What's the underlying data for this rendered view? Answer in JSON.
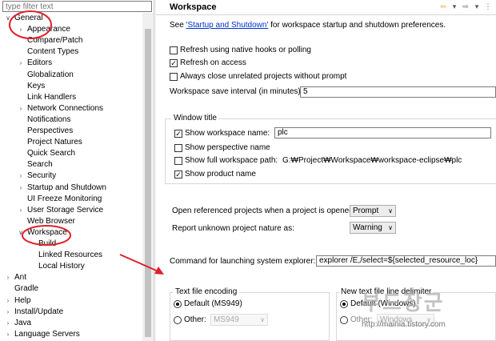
{
  "left": {
    "filter_placeholder": "type filter text",
    "tree": [
      {
        "label": "General",
        "twisty": "v"
      },
      {
        "label": "Appearance",
        "twisty": ">"
      },
      {
        "label": "Compare/Patch",
        "twisty": ""
      },
      {
        "label": "Content Types",
        "twisty": ""
      },
      {
        "label": "Editors",
        "twisty": ">"
      },
      {
        "label": "Globalization",
        "twisty": ""
      },
      {
        "label": "Keys",
        "twisty": ""
      },
      {
        "label": "Link Handlers",
        "twisty": ""
      },
      {
        "label": "Network Connections",
        "twisty": ">"
      },
      {
        "label": "Notifications",
        "twisty": ""
      },
      {
        "label": "Perspectives",
        "twisty": ""
      },
      {
        "label": "Project Natures",
        "twisty": ""
      },
      {
        "label": "Quick Search",
        "twisty": ""
      },
      {
        "label": "Search",
        "twisty": ""
      },
      {
        "label": "Security",
        "twisty": ">"
      },
      {
        "label": "Startup and Shutdown",
        "twisty": ">"
      },
      {
        "label": "UI Freeze Monitoring",
        "twisty": ""
      },
      {
        "label": "User Storage Service",
        "twisty": ">"
      },
      {
        "label": "Web Browser",
        "twisty": ""
      },
      {
        "label": "Workspace",
        "twisty": "v"
      },
      {
        "label": "Build",
        "twisty": ""
      },
      {
        "label": "Linked Resources",
        "twisty": ""
      },
      {
        "label": "Local History",
        "twisty": ""
      },
      {
        "label": "Ant",
        "twisty": ">"
      },
      {
        "label": "Gradle",
        "twisty": ""
      },
      {
        "label": "Help",
        "twisty": ">"
      },
      {
        "label": "Install/Update",
        "twisty": ">"
      },
      {
        "label": "Java",
        "twisty": ">"
      },
      {
        "label": "Language Servers",
        "twisty": ">"
      }
    ]
  },
  "right": {
    "title": "Workspace",
    "see_prefix": "See ",
    "see_link": "'Startup and Shutdown'",
    "see_suffix": " for workspace startup and shutdown preferences.",
    "refresh_native": "Refresh using native hooks or polling",
    "refresh_access": "Refresh on access",
    "close_unrelated": "Always close unrelated projects without prompt",
    "save_interval_label": "Workspace save interval (in minutes):",
    "save_interval_value": "5",
    "window_title_group": "Window title",
    "show_ws_name": "Show workspace name:",
    "ws_name_value": "plc",
    "show_perspective": "Show perspective name",
    "show_full_path": "Show full workspace path:",
    "full_path_value": "G:₩Project₩Workspace₩workspace-eclipse₩plc",
    "show_product": "Show product name",
    "open_ref_label": "Open referenced projects when a project is opened:",
    "open_ref_value": "Prompt",
    "report_unknown_label": "Report unknown project nature as:",
    "report_unknown_value": "Warning",
    "cmd_label": "Command for launching system explorer:",
    "cmd_value": "explorer /E,/select=${selected_resource_loc}",
    "text_enc_group": "Text file encoding",
    "enc_default": "Default (MS949)",
    "enc_other": "Other:",
    "enc_other_value": "MS949",
    "line_delim_group": "New text file line delimiter",
    "delim_default": "Default (Windows)",
    "delim_other": "Other:",
    "delim_other_value": "Windows"
  },
  "watermark": {
    "text": "부드장군",
    "url": "http://mainia.tistory.com"
  },
  "colors": {
    "annotation": "#e0202a",
    "link": "#0033cc"
  }
}
